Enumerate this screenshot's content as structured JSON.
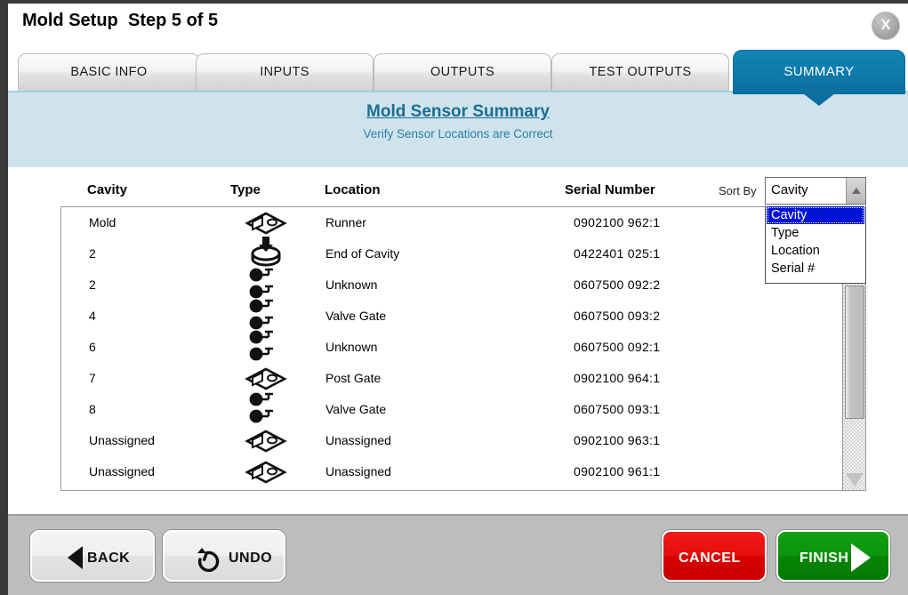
{
  "window": {
    "title": "Mold Setup",
    "step": "Step 5 of 5",
    "close_icon": "close-icon",
    "close_glyph": "X"
  },
  "tabs": [
    {
      "label": "BASIC INFO",
      "active": false
    },
    {
      "label": "INPUTS",
      "active": false
    },
    {
      "label": "OUTPUTS",
      "active": false
    },
    {
      "label": "TEST OUTPUTS",
      "active": false
    },
    {
      "label": "SUMMARY",
      "active": true
    }
  ],
  "banner": {
    "title": "Mold Sensor Summary",
    "subtitle": "Verify Sensor Locations are Correct",
    "bg_color": "#cfe3ed",
    "title_color": "#1a6e93"
  },
  "table": {
    "columns": [
      "Cavity",
      "Type",
      "Location",
      "Serial Number"
    ],
    "rows": [
      {
        "cavity": "Mold",
        "type_icon": "pressure-sensor-icon",
        "location": "Runner",
        "serial": "0902100 962:1"
      },
      {
        "cavity": "2",
        "type_icon": "cavity-end-sensor-icon",
        "location": "End of Cavity",
        "serial": "0422401 025:1"
      },
      {
        "cavity": "2",
        "type_icon": "thermocouple-pair-icon",
        "location": "Unknown",
        "serial": "0607500 092:2"
      },
      {
        "cavity": "4",
        "type_icon": "thermocouple-pair-icon",
        "location": "Valve Gate",
        "serial": "0607500 093:2"
      },
      {
        "cavity": "6",
        "type_icon": "thermocouple-pair-icon",
        "location": "Unknown",
        "serial": "0607500 092:1"
      },
      {
        "cavity": "7",
        "type_icon": "pressure-sensor-icon",
        "location": "Post Gate",
        "serial": "0902100 964:1"
      },
      {
        "cavity": "8",
        "type_icon": "thermocouple-pair-icon",
        "location": "Valve Gate",
        "serial": "0607500 093:1"
      },
      {
        "cavity": "Unassigned",
        "type_icon": "pressure-sensor-icon",
        "location": "Unassigned",
        "serial": "0902100 963:1"
      },
      {
        "cavity": "Unassigned",
        "type_icon": "pressure-sensor-icon",
        "location": "Unassigned",
        "serial": "0902100 961:1"
      }
    ]
  },
  "sort": {
    "label": "Sort By",
    "value": "Cavity",
    "expanded": true,
    "options": [
      "Cavity",
      "Type",
      "Location",
      "Serial #"
    ],
    "selected_index": 0,
    "highlight_color": "#0013d6"
  },
  "footer": {
    "back_label": "BACK",
    "undo_label": "UNDO",
    "cancel_label": "CANCEL",
    "finish_label": "FINISH",
    "cancel_color": "#d60000",
    "finish_color": "#068506"
  }
}
